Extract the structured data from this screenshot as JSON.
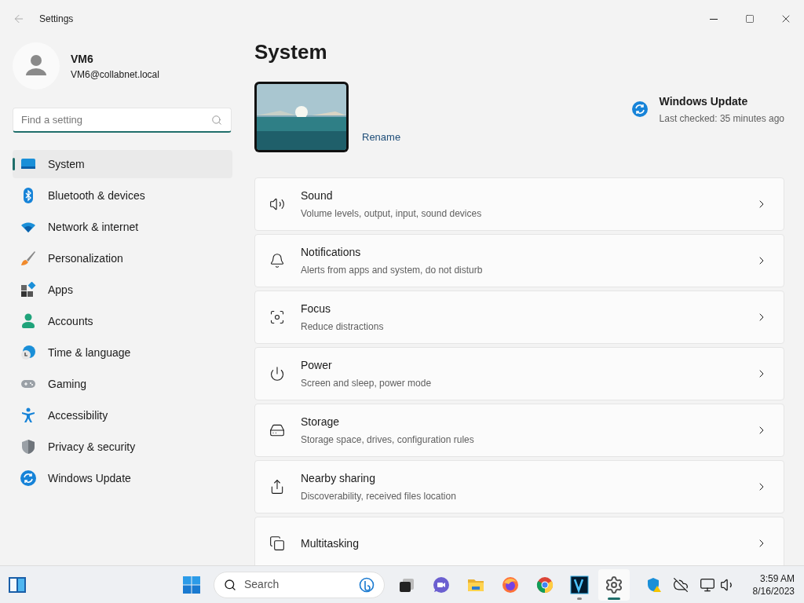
{
  "window": {
    "title": "Settings"
  },
  "profile": {
    "name": "VM6",
    "email": "VM6@collabnet.local"
  },
  "search": {
    "placeholder": "Find a setting"
  },
  "sidebar": {
    "items": [
      {
        "label": "System",
        "kind": "system",
        "selected": true
      },
      {
        "label": "Bluetooth & devices",
        "kind": "bluetooth",
        "selected": false
      },
      {
        "label": "Network & internet",
        "kind": "network",
        "selected": false
      },
      {
        "label": "Personalization",
        "kind": "brush",
        "selected": false
      },
      {
        "label": "Apps",
        "kind": "apps",
        "selected": false
      },
      {
        "label": "Accounts",
        "kind": "accounts",
        "selected": false
      },
      {
        "label": "Time & language",
        "kind": "time",
        "selected": false
      },
      {
        "label": "Gaming",
        "kind": "gaming",
        "selected": false
      },
      {
        "label": "Accessibility",
        "kind": "accessibility",
        "selected": false
      },
      {
        "label": "Privacy & security",
        "kind": "privacy",
        "selected": false
      },
      {
        "label": "Windows Update",
        "kind": "update",
        "selected": false
      }
    ]
  },
  "page": {
    "title": "System",
    "rename": "Rename",
    "update": {
      "title": "Windows Update",
      "status": "Last checked: 35 minutes ago"
    },
    "cards": [
      {
        "title": "Sound",
        "subtitle": "Volume levels, output, input, sound devices",
        "kind": "sound"
      },
      {
        "title": "Notifications",
        "subtitle": "Alerts from apps and system, do not disturb",
        "kind": "notifications"
      },
      {
        "title": "Focus",
        "subtitle": "Reduce distractions",
        "kind": "focus"
      },
      {
        "title": "Power",
        "subtitle": "Screen and sleep, power mode",
        "kind": "power"
      },
      {
        "title": "Storage",
        "subtitle": "Storage space, drives, configuration rules",
        "kind": "storage"
      },
      {
        "title": "Nearby sharing",
        "subtitle": "Discoverability, received files location",
        "kind": "share"
      },
      {
        "title": "Multitasking",
        "kind": "multitasking"
      }
    ]
  },
  "taskbar": {
    "search": "Search",
    "apps": [
      {
        "kind": "taskview",
        "running": false,
        "selected": false
      },
      {
        "kind": "chat",
        "running": false,
        "selected": false
      },
      {
        "kind": "files",
        "running": false,
        "selected": false
      },
      {
        "kind": "firefox",
        "running": false,
        "selected": false
      },
      {
        "kind": "chrome",
        "running": false,
        "selected": false
      },
      {
        "kind": "vapp",
        "running": true,
        "selected": false
      },
      {
        "kind": "settings",
        "running": true,
        "selected": true
      }
    ],
    "time": "3:59 AM",
    "date": "8/16/2023"
  }
}
